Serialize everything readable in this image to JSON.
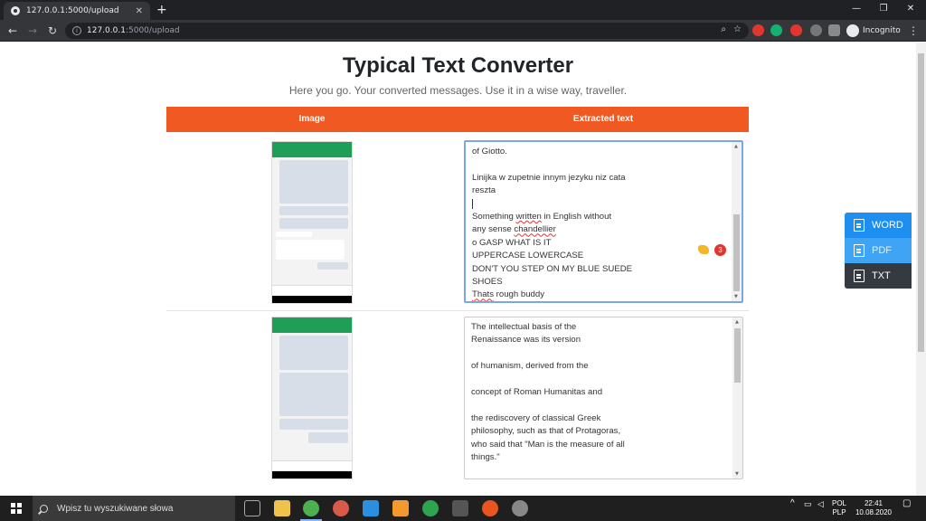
{
  "browser": {
    "tab_title": "127.0.0.1:5000/upload",
    "tab_close": "✕",
    "new_tab": "+",
    "url_host": "127.0.0.1",
    "url_path": ":5000/upload",
    "profile": "Incognito",
    "window_min": "—",
    "window_max": "❐",
    "window_close": "✕"
  },
  "page": {
    "title": "Typical Text Converter",
    "subtitle": "Here you go. Your converted messages. Use it in a wise way, traveller.",
    "columns": [
      "Image",
      "Extracted text"
    ]
  },
  "rows": [
    {
      "lines": [
        "of Giotto.",
        "",
        "Linijka w zupetnie innym jezyku niz cata",
        "reszta",
        "",
        "Something written in English without",
        "any sense chandellier",
        "o GASP WHAT IS IT",
        "UPPERCASE LOWERCASE",
        "DON'T YOU STEP ON MY BLUE SUEDE",
        "SHOES",
        "Thats rough buddy"
      ],
      "grammarly_count": "3"
    },
    {
      "lines": [
        "The intellectual basis of the",
        "Renaissance was its version",
        "",
        "of humanism, derived from the",
        "",
        "concept of Roman Humanitas and",
        "",
        "the rediscovery of classical Greek",
        "philosophy, such as that of Protagoras,",
        "who said that \"Man is the measure of all",
        "things.\""
      ]
    }
  ],
  "export": {
    "word": "WORD",
    "pdf": "PDF",
    "txt": "TXT"
  },
  "taskbar": {
    "search_placeholder": "Wpisz tu wyszukiwane słowa",
    "lang_top": "POL",
    "lang_bottom": "PLP",
    "time": "22:41",
    "date": "10.08.2020"
  }
}
